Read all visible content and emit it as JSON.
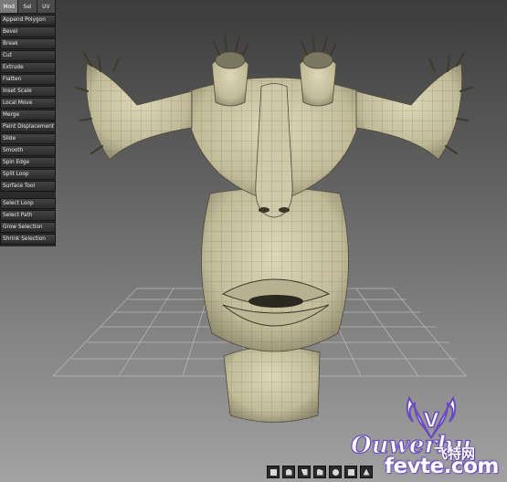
{
  "tool_panel": {
    "tabs": [
      {
        "label": "Mod",
        "active": true
      },
      {
        "label": "Sel",
        "active": false
      },
      {
        "label": "UV",
        "active": false
      }
    ],
    "mod_tools": [
      "Append Polygon",
      "Bevel",
      "Break",
      "Cut",
      "Extrude",
      "Flatten",
      "Inset Scale",
      "Local Move",
      "Merge",
      "Paint Displacement",
      "Slide",
      "Smooth",
      "Spin Edge",
      "Split Loop",
      "Surface Tool"
    ],
    "selection_tools": [
      "Select Loop",
      "Select Path",
      "Grow Selection",
      "Shrink Selection"
    ]
  },
  "viewport": {
    "object": "mesh-head-model",
    "grid_visible": true,
    "background_top": "#3c3c3c",
    "background_bottom": "#a2a2a2",
    "mesh_color": "#cbc5a6"
  },
  "bottom_toolbar": {
    "icons": [
      "vertex-mode-icon",
      "edge-mode-icon",
      "face-mode-icon",
      "object-mode-icon",
      "separator",
      "sphere-display-icon",
      "wireframe-icon",
      "light-icon"
    ]
  },
  "watermark": {
    "logo_letter": "V",
    "ribbon_text": "Ouwerhu",
    "cn_text": "飞特网",
    "domain": "fevte.com",
    "accent": "#6a4ac2"
  }
}
